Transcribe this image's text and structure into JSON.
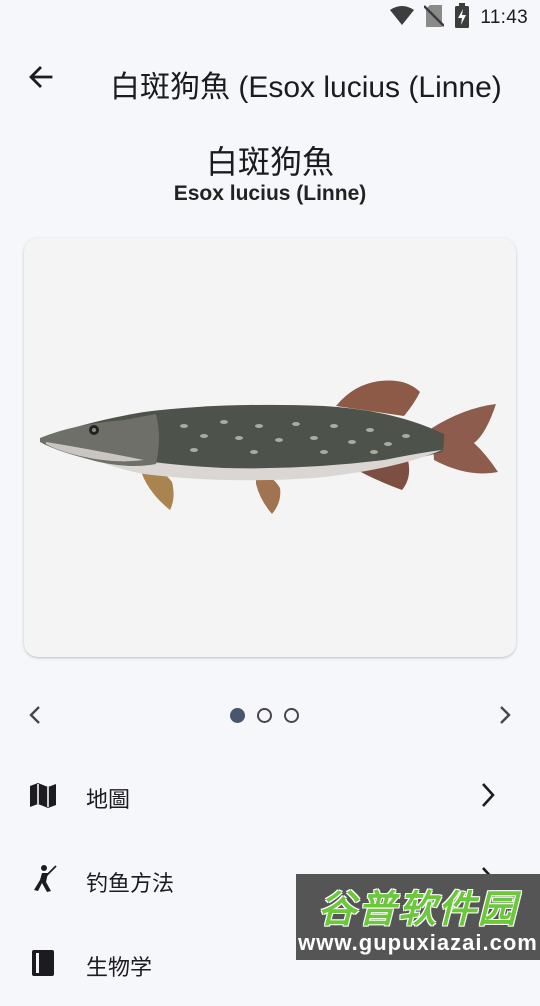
{
  "status_bar": {
    "time": "11:43",
    "icons": [
      "wifi-icon",
      "no-sim-icon",
      "battery-charging-icon"
    ]
  },
  "app_bar": {
    "title": "白斑狗魚 (Esox lucius (Linne)",
    "back_icon": "arrow-back-icon"
  },
  "header": {
    "name_cn": "白斑狗魚",
    "name_latin": "Esox lucius (Linne)"
  },
  "carousel": {
    "image_subject": "northern pike illustration",
    "page_count": 3,
    "active_index": 0,
    "prev_icon": "chevron-left-icon",
    "next_icon": "chevron-right-icon"
  },
  "menu": {
    "items": [
      {
        "label": "地圖",
        "icon": "map-icon"
      },
      {
        "label": "钓鱼方法",
        "icon": "fishing-person-icon"
      },
      {
        "label": "生物学",
        "icon": "book-icon"
      }
    ]
  },
  "watermark": {
    "title": "谷普软件园",
    "url": "www.gupuxiazai.com"
  },
  "colors": {
    "background": "#f6f7fb",
    "card": "#f4f4f4",
    "dot_active": "#49566e",
    "watermark_green": "#6bc83b"
  }
}
